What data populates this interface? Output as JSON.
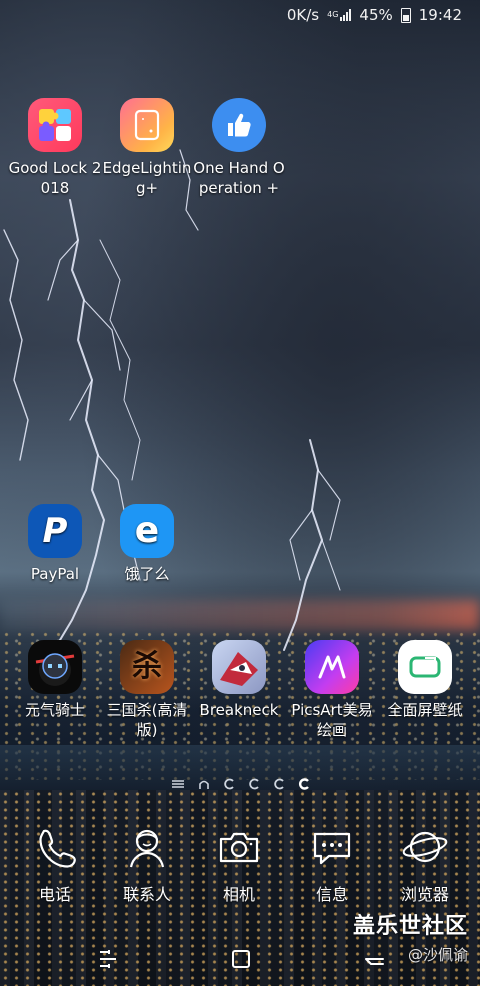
{
  "status_bar": {
    "net_speed": "0K/s",
    "network": "4G",
    "battery": "45%",
    "time": "19:42"
  },
  "home": {
    "row1": [
      {
        "label": "Good Lock 2018",
        "icon": "good-lock-icon"
      },
      {
        "label": "EdgeLighting+",
        "icon": "edge-lighting-icon"
      },
      {
        "label": "One Hand Operation +",
        "icon": "thumbs-up-icon"
      }
    ],
    "row2": [
      {
        "label": "PayPal",
        "icon": "paypal-icon",
        "glyph": "P"
      },
      {
        "label": "饿了么",
        "icon": "eleme-icon",
        "glyph": "e"
      }
    ],
    "row3": [
      {
        "label": "元气骑士",
        "icon": "soul-knight-icon"
      },
      {
        "label": "三国杀(高清版)",
        "icon": "sanguosha-icon",
        "glyph": "杀"
      },
      {
        "label": "Breakneck",
        "icon": "breakneck-icon"
      },
      {
        "label": "PicsArt美易绘画",
        "icon": "picsart-icon"
      },
      {
        "label": "全面屏壁纸",
        "icon": "fullscreen-wallpaper-icon"
      }
    ]
  },
  "page_indicator": {
    "pages": 6,
    "current_index": 5
  },
  "dock": [
    {
      "label": "电话",
      "icon": "phone-icon"
    },
    {
      "label": "联系人",
      "icon": "contacts-icon"
    },
    {
      "label": "相机",
      "icon": "camera-icon"
    },
    {
      "label": "信息",
      "icon": "messages-icon"
    },
    {
      "label": "浏览器",
      "icon": "browser-icon"
    }
  ],
  "watermark": {
    "title": "盖乐世社区",
    "author": "@沙佩谕"
  },
  "colors": {
    "paypal": "#0d57b7",
    "eleme": "#1e96f5",
    "onehand": "#3d8ef0"
  }
}
